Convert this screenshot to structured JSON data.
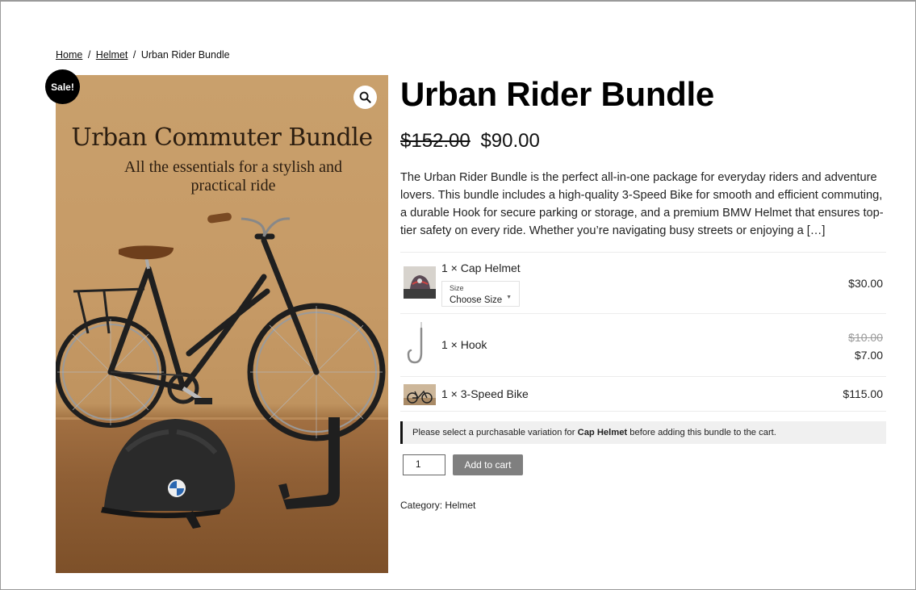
{
  "breadcrumb": {
    "home": "Home",
    "separator": "/",
    "category": "Helmet",
    "current": "Urban Rider Bundle"
  },
  "badge": {
    "sale": "Sale!"
  },
  "image": {
    "headline": "Urban Commuter Bundle",
    "tagline": "All the essentials for a stylish and practical ride",
    "zoom_icon": "magnifier-icon"
  },
  "product": {
    "title": "Urban Rider Bundle",
    "regular_price": "$152.00",
    "sale_price": "$90.00",
    "description": "The Urban Rider Bundle is the perfect all-in-one package for everyday riders and adventure lovers. This bundle includes a high-quality 3-Speed Bike for smooth and efficient commuting, a durable Hook for secure parking or storage, and a premium BMW Helmet that ensures top-tier safety on every ride. Whether you’re navigating busy streets or enjoying a […]"
  },
  "bundle_items": [
    {
      "name": "1 × Cap Helmet",
      "price": "$30.00",
      "variation_label": "Size",
      "variation_value": "Choose Size"
    },
    {
      "name": "1 × Hook",
      "regular_price": "$10.00",
      "price": "$7.00"
    },
    {
      "name": "1 × 3-Speed Bike",
      "price": "$115.00"
    }
  ],
  "notice": {
    "prefix": "Please select a purchasable variation for",
    "product": "Cap Helmet",
    "suffix": "before adding this bundle to the cart."
  },
  "cart": {
    "quantity": "1",
    "button_label": "Add to cart"
  },
  "meta": {
    "category_label": "Category:",
    "category_value": "Helmet"
  },
  "colors": {
    "button_bg": "#7f7f7f",
    "badge_bg": "#000000",
    "notice_bg": "#f0f0f0"
  }
}
